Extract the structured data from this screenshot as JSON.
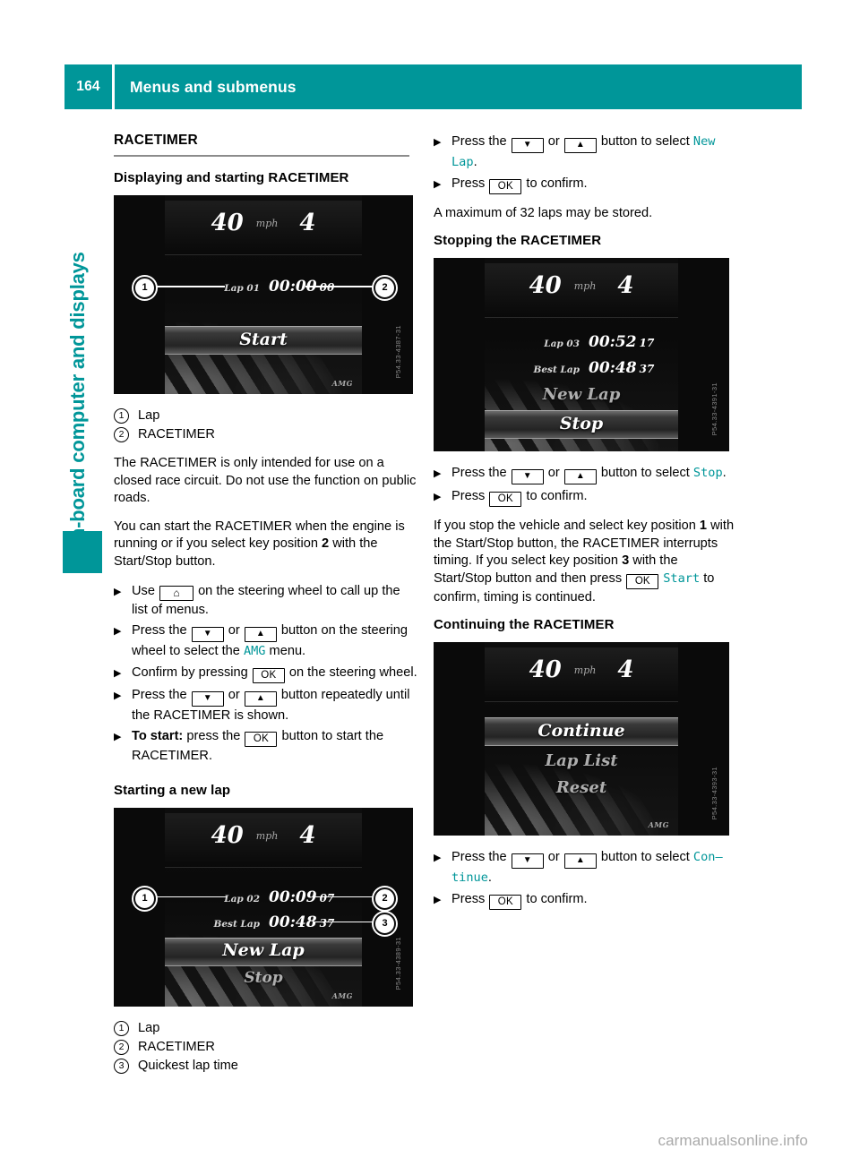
{
  "header": {
    "page_number": "164",
    "title": "Menus and submenus"
  },
  "sidebar": {
    "chapter_label": "On-board computer and displays",
    "accent_color": "#009699"
  },
  "left_column": {
    "section_title": "RACETIMER",
    "sub1_title": "Displaying and starting RACETIMER",
    "display1": {
      "speed": "40",
      "unit": "mph",
      "gear": "4",
      "lap_label": "Lap 01",
      "lap_time": "00:00",
      "lap_time_frac": "00",
      "menu_item": "Start",
      "brand": "AMG",
      "part_number": "P54.33-4387-31",
      "callouts": [
        "1",
        "2"
      ]
    },
    "legend1": [
      {
        "num": "1",
        "text": "Lap"
      },
      {
        "num": "2",
        "text": "RACETIMER"
      }
    ],
    "para1": "The RACETIMER is only intended for use on a closed race circuit. Do not use the function on public roads.",
    "para2_a": "You can start the RACETIMER when the engine is running or if you select key position ",
    "para2_b": "2",
    "para2_c": " with the Start/Stop button.",
    "steps": [
      {
        "parts": [
          {
            "t": "text",
            "v": "Use "
          },
          {
            "t": "key",
            "v": "⌂",
            "name": "home-key"
          },
          {
            "t": "text",
            "v": " on the steering wheel to call up the list of menus."
          }
        ]
      },
      {
        "parts": [
          {
            "t": "text",
            "v": "Press the "
          },
          {
            "t": "key",
            "v": "▼",
            "name": "down-key"
          },
          {
            "t": "text",
            "v": " or "
          },
          {
            "t": "key",
            "v": "▲",
            "name": "up-key"
          },
          {
            "t": "text",
            "v": " button on the steering wheel to select the "
          },
          {
            "t": "teal",
            "v": "AMG"
          },
          {
            "t": "text",
            "v": " menu."
          }
        ]
      },
      {
        "parts": [
          {
            "t": "text",
            "v": "Confirm by pressing "
          },
          {
            "t": "key",
            "v": "OK",
            "name": "ok-key"
          },
          {
            "t": "text",
            "v": " on the steering wheel."
          }
        ]
      },
      {
        "parts": [
          {
            "t": "text",
            "v": "Press the "
          },
          {
            "t": "key",
            "v": "▼",
            "name": "down-key"
          },
          {
            "t": "text",
            "v": " or "
          },
          {
            "t": "key",
            "v": "▲",
            "name": "up-key"
          },
          {
            "t": "text",
            "v": " button repeatedly until the RACETIMER is shown."
          }
        ]
      },
      {
        "parts": [
          {
            "t": "bold",
            "v": "To start:"
          },
          {
            "t": "text",
            "v": " press the "
          },
          {
            "t": "key",
            "v": "OK",
            "name": "ok-key"
          },
          {
            "t": "text",
            "v": " button to start the RACETIMER."
          }
        ]
      }
    ],
    "sub2_title": "Starting a new lap",
    "display2": {
      "speed": "40",
      "unit": "mph",
      "gear": "4",
      "lap_label": "Lap 02",
      "lap_time": "00:09",
      "lap_time_frac": "07",
      "best_label": "Best Lap",
      "best_time": "00:48",
      "best_time_frac": "37",
      "menu_item_1": "New Lap",
      "menu_item_2": "Stop",
      "brand": "AMG",
      "part_number": "P54.33-4389-31",
      "callouts": [
        "1",
        "2",
        "3"
      ]
    },
    "legend2": [
      {
        "num": "1",
        "text": "Lap"
      },
      {
        "num": "2",
        "text": "RACETIMER"
      },
      {
        "num": "3",
        "text": "Quickest lap time"
      }
    ]
  },
  "right_column": {
    "steps_top": [
      {
        "parts": [
          {
            "t": "text",
            "v": "Press the "
          },
          {
            "t": "key",
            "v": "▼",
            "name": "down-key"
          },
          {
            "t": "text",
            "v": " or "
          },
          {
            "t": "key",
            "v": "▲",
            "name": "up-key"
          },
          {
            "t": "text",
            "v": " button to select "
          },
          {
            "t": "teal",
            "v": "New Lap"
          },
          {
            "t": "text",
            "v": "."
          }
        ]
      },
      {
        "parts": [
          {
            "t": "text",
            "v": "Press "
          },
          {
            "t": "key",
            "v": "OK",
            "name": "ok-key"
          },
          {
            "t": "text",
            "v": " to confirm."
          }
        ]
      }
    ],
    "para_max_laps": "A maximum of 32 laps may be stored.",
    "sub1_title": "Stopping the RACETIMER",
    "display3": {
      "speed": "40",
      "unit": "mph",
      "gear": "4",
      "lap_label": "Lap 03",
      "lap_time": "00:52",
      "lap_time_frac": "17",
      "best_label": "Best Lap",
      "best_time": "00:48",
      "best_time_frac": "37",
      "menu_item_1": "New Lap",
      "menu_item_2": "Stop",
      "part_number": "P54.33-4391-31"
    },
    "steps_mid": [
      {
        "parts": [
          {
            "t": "text",
            "v": "Press the "
          },
          {
            "t": "key",
            "v": "▼",
            "name": "down-key"
          },
          {
            "t": "text",
            "v": " or "
          },
          {
            "t": "key",
            "v": "▲",
            "name": "up-key"
          },
          {
            "t": "text",
            "v": " button to select "
          },
          {
            "t": "teal",
            "v": "Stop"
          },
          {
            "t": "text",
            "v": "."
          }
        ]
      },
      {
        "parts": [
          {
            "t": "text",
            "v": "Press "
          },
          {
            "t": "key",
            "v": "OK",
            "name": "ok-key"
          },
          {
            "t": "text",
            "v": " to confirm."
          }
        ]
      }
    ],
    "para_keypos": {
      "a": "If you stop the vehicle and select key position ",
      "b1": "1",
      "c": " with the Start/Stop button, the RACETIMER interrupts timing. If you select key position ",
      "b2": "3",
      "d": " with the Start/Stop button and then press ",
      "key": "OK",
      "teal": "Start",
      "e": " to confirm, timing is continued."
    },
    "sub2_title": "Continuing the RACETIMER",
    "display4": {
      "speed": "40",
      "unit": "mph",
      "gear": "4",
      "menu_item_1": "Continue",
      "menu_item_2": "Lap List",
      "menu_item_3": "Reset",
      "brand": "AMG",
      "part_number": "P54.33-4393-31"
    },
    "steps_bottom": [
      {
        "parts": [
          {
            "t": "text",
            "v": "Press the "
          },
          {
            "t": "key",
            "v": "▼",
            "name": "down-key"
          },
          {
            "t": "text",
            "v": " or "
          },
          {
            "t": "key",
            "v": "▲",
            "name": "up-key"
          },
          {
            "t": "text",
            "v": " button to select "
          },
          {
            "t": "teal",
            "v": "Con–tinue"
          },
          {
            "t": "text",
            "v": "."
          }
        ]
      },
      {
        "parts": [
          {
            "t": "text",
            "v": "Press "
          },
          {
            "t": "key",
            "v": "OK",
            "name": "ok-key"
          },
          {
            "t": "text",
            "v": " to confirm."
          }
        ]
      }
    ]
  },
  "footer": {
    "watermark": "carmanualsonline.info"
  }
}
